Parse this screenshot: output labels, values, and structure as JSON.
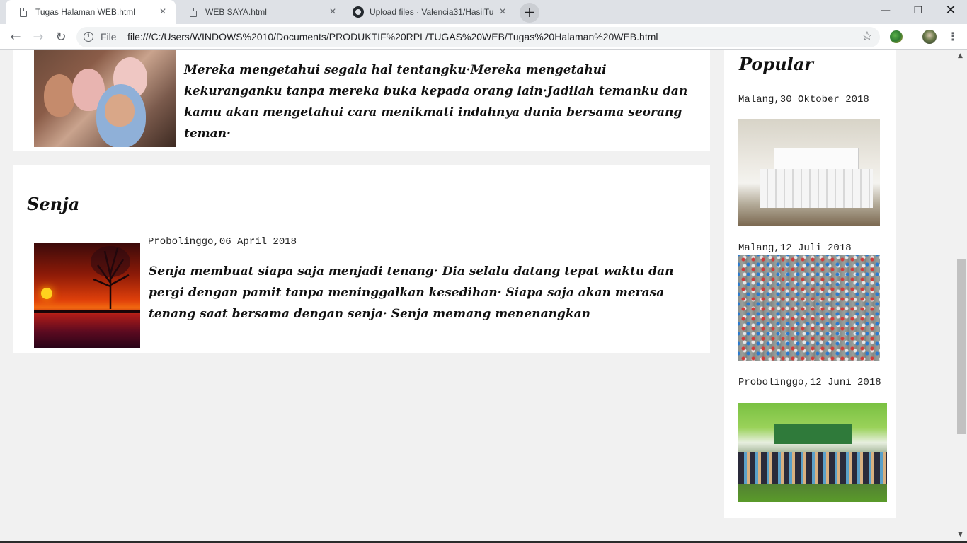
{
  "browser": {
    "tabs": [
      {
        "title": "Tugas Halaman WEB.html",
        "active": true,
        "icon": "document-icon"
      },
      {
        "title": "WEB SAYA.html",
        "active": false,
        "icon": "document-icon"
      },
      {
        "title": "Upload files · Valencia31/HasilTu",
        "active": false,
        "icon": "github-icon"
      }
    ],
    "new_tab_label": "+",
    "url_scheme": "File",
    "url": "file:///C:/Users/WINDOWS%2010/Documents/PRODUKTIF%20RPL/TUGAS%20WEB/Tugas%20Halaman%20WEB.html",
    "colors": {
      "tabbar": "#dee1e6",
      "toolbar": "#ffffff",
      "omnibox": "#f1f3f4"
    }
  },
  "page": {
    "post1": {
      "text": "Mereka mengetahui segala hal tentangku·Mereka mengetahui kekuranganku tanpa mereka buka kepada orang lain·Jadilah temanku dan kamu akan mengetahui cara menikmati indahnya dunia bersama seorang teman·"
    },
    "post2": {
      "title": "Senja",
      "date": "Probolinggo,06 April 2018",
      "text": "Senja membuat siapa saja menjadi tenang· Dia selalu datang tepat waktu dan pergi dengan pamit tanpa meninggalkan kesedihan· Siapa saja akan merasa tenang saat bersama dengan senja· Senja memang menenangkan"
    },
    "sidebar": {
      "title": "Popular",
      "items": [
        {
          "date": "Malang,30 Oktober 2018"
        },
        {
          "date": "Malang,12 Juli 2018"
        },
        {
          "date": "Probolinggo,12 Juni 2018"
        }
      ]
    },
    "colors": {
      "background": "#f1f1f1",
      "card": "#ffffff"
    }
  }
}
